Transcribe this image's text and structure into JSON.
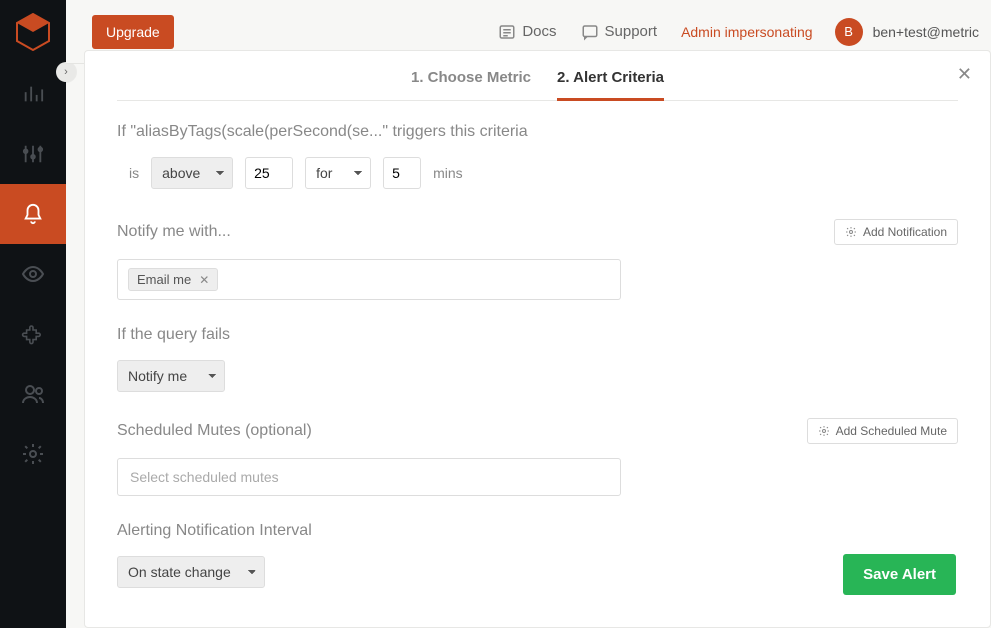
{
  "topbar": {
    "upgrade": "Upgrade",
    "docs": "Docs",
    "support": "Support",
    "impersonating": "Admin impersonating",
    "avatar_initial": "B",
    "user_email": "ben+test@metric"
  },
  "modal": {
    "tabs": {
      "choose_metric": "1. Choose Metric",
      "alert_criteria": "2. Alert Criteria"
    },
    "criteria_sentence": "If \"aliasByTags(scale(perSecond(se...\" triggers this criteria",
    "criteria": {
      "is_label": "is",
      "comparator": "above",
      "threshold": "25",
      "for_label": "for",
      "duration": "5",
      "mins_label": "mins"
    },
    "notify": {
      "title": "Notify me with...",
      "add_label": "Add Notification",
      "tag": "Email me"
    },
    "fail": {
      "title": "If the query fails",
      "value": "Notify me"
    },
    "mutes": {
      "title": "Scheduled Mutes (optional)",
      "add_label": "Add Scheduled Mute",
      "placeholder": "Select scheduled mutes"
    },
    "interval": {
      "title": "Alerting Notification Interval",
      "value": "On state change"
    },
    "save": "Save Alert"
  }
}
